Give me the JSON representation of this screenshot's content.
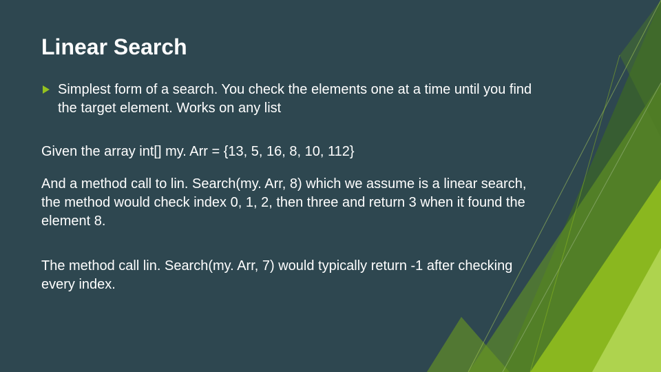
{
  "colors": {
    "background": "#2e4750",
    "accent_green_light": "#94c11f",
    "accent_green_mid": "#6a9a1f",
    "accent_green_dark": "#3f6f1a",
    "text": "#ffffff"
  },
  "slide": {
    "title": "Linear Search",
    "bullet_icon": "play-triangle-icon",
    "bullet_text": "Simplest form of a search.   You check the elements one at a time until you find the target element.  Works on any list",
    "paragraphs": [
      "Given the array int[] my. Arr = {13, 5, 16, 8, 10, 112}",
      "And a method call to lin. Search(my. Arr, 8) which we assume is a linear search, the method would check index 0, 1, 2, then three and return 3 when it found the element 8.",
      "The method call lin. Search(my. Arr, 7) would typically return -1 after checking every index."
    ]
  }
}
